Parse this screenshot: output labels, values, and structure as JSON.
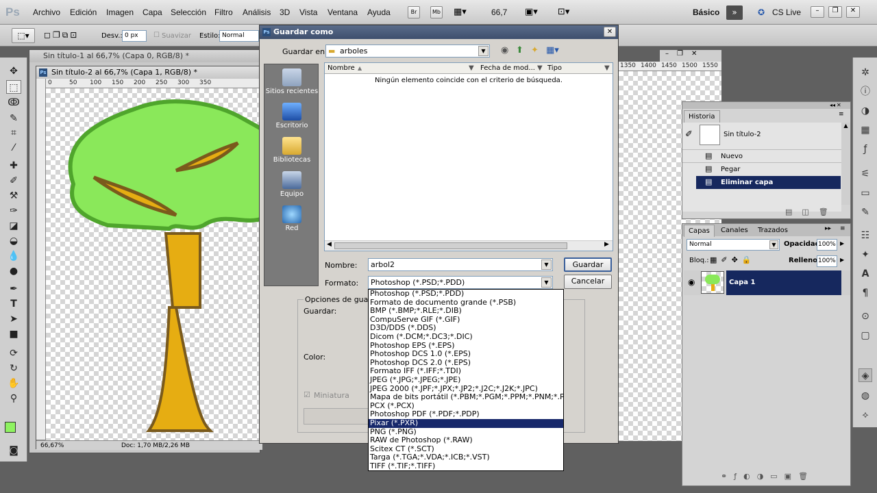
{
  "app": {
    "logo": "Ps",
    "workspace": "Básico",
    "cslive": "CS Live",
    "zoom": "66,7"
  },
  "menu": [
    "Archivo",
    "Edición",
    "Imagen",
    "Capa",
    "Selección",
    "Filtro",
    "Análisis",
    "3D",
    "Vista",
    "Ventana",
    "Ayuda"
  ],
  "options": {
    "desv_label": "Desv.:",
    "desv_value": "0 px",
    "suavizar": "Suavizar",
    "estilo_label": "Estilo:",
    "estilo_value": "Normal"
  },
  "docs": {
    "doc1_title": "Sin título-1 al 66,7% (Capa 0, RGB/8) *",
    "doc2_title": "Sin título-2 al 66,7% (Capa 1, RGB/8) *",
    "ruler_marks": [
      "0",
      "50",
      "100",
      "150",
      "200",
      "250",
      "300",
      "350"
    ],
    "ruler_right": [
      "1350",
      "1400",
      "1450",
      "1500",
      "1550"
    ],
    "status_zoom": "66,67%",
    "status_doc": "Doc: 1,70 MB/2,26 MB"
  },
  "dialog": {
    "title": "Guardar como",
    "save_in_label": "Guardar en:",
    "save_in_value": "arboles",
    "nav": [
      "Sitios recientes",
      "Escritorio",
      "Bibliotecas",
      "Equipo",
      "Red"
    ],
    "col_name": "Nombre",
    "col_date": "Fecha de mod...",
    "col_type": "Tipo",
    "empty_msg": "Ningún elemento coincide con el criterio de búsqueda.",
    "name_label": "Nombre:",
    "name_value": "arbol2",
    "format_label": "Formato:",
    "format_value": "Photoshop (*.PSD;*.PDD)",
    "save_button": "Guardar",
    "cancel_button": "Cancelar",
    "options_label": "Opciones de guard",
    "guardar_label": "Guardar:",
    "color_label": "Color:",
    "miniatura_label": "Miniatura"
  },
  "formats": [
    "Photoshop (*.PSD;*.PDD)",
    "Formato de documento grande (*.PSB)",
    "BMP (*.BMP;*.RLE;*.DIB)",
    "CompuServe GIF (*.GIF)",
    "D3D/DDS (*.DDS)",
    "Dicom (*.DCM;*.DC3;*.DIC)",
    "Photoshop EPS (*.EPS)",
    "Photoshop DCS 1.0 (*.EPS)",
    "Photoshop DCS 2.0 (*.EPS)",
    "Formato IFF (*.IFF;*.TDI)",
    "JPEG (*.JPG;*.JPEG;*.JPE)",
    "JPEG 2000 (*.JPF;*.JPX;*.JP2;*.J2C;*.J2K;*.JPC)",
    "Mapa de bits portátil (*.PBM;*.PGM;*.PPM;*.PNM;*.PFM;*.PAM)",
    "PCX (*.PCX)",
    "Photoshop PDF (*.PDF;*.PDP)",
    "Pixar (*.PXR)",
    "PNG (*.PNG)",
    "RAW de Photoshop (*.RAW)",
    "Scitex CT (*.SCT)",
    "Targa (*.TGA;*.VDA;*.ICB;*.VST)",
    "TIFF (*.TIF;*.TIFF)"
  ],
  "selected_format_index": 15,
  "history": {
    "title": "Historia",
    "snapshot": "Sin título-2",
    "items": [
      "Nuevo",
      "Pegar",
      "Eliminar capa"
    ]
  },
  "layers": {
    "tabs": [
      "Capas",
      "Canales",
      "Trazados"
    ],
    "blend": "Normal",
    "opacity_label": "Opacidad:",
    "opacity_value": "100%",
    "lock_label": "Bloq.:",
    "fill_label": "Relleno:",
    "fill_value": "100%",
    "layer_name": "Capa 1"
  },
  "colors": {
    "foreground": "#8ef260",
    "background": "#ffffff"
  }
}
